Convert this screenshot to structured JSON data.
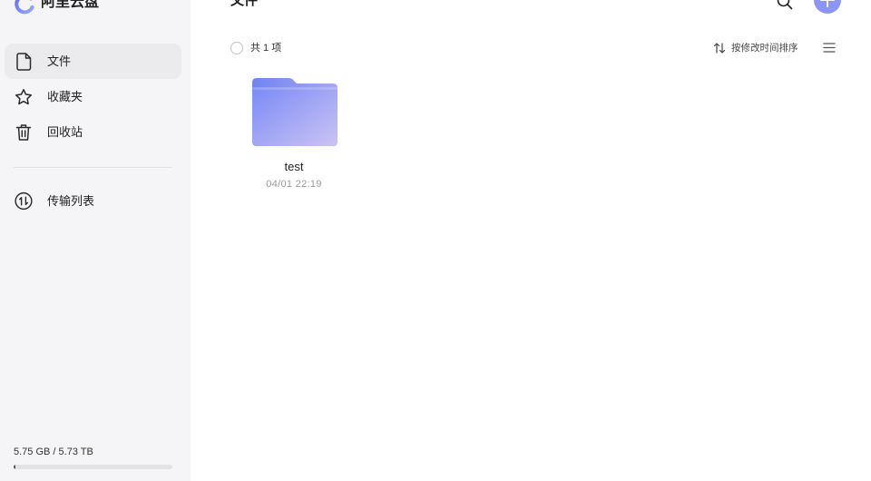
{
  "app": {
    "logo_text": "阿里云盘",
    "logo_icon": "aliyun-drive-logo"
  },
  "sidebar": {
    "nav": [
      {
        "label": "文件",
        "icon": "file-icon",
        "selected": true
      },
      {
        "label": "收藏夹",
        "icon": "star-icon",
        "selected": false
      },
      {
        "label": "回收站",
        "icon": "trash-icon",
        "selected": false
      }
    ],
    "transfer": {
      "label": "传输列表",
      "icon": "transfer-icon"
    },
    "storage": {
      "text": "5.75 GB / 5.73 TB",
      "used_fraction": 0.001
    }
  },
  "main": {
    "title": "文件",
    "search_icon": "search-icon",
    "add_icon": "plus-icon",
    "summary": "共 1 项",
    "sort_icon": "sort-icon",
    "sort_label": "按修改时间排序",
    "view_icon": "list-view-icon",
    "files": [
      {
        "name": "test",
        "modified": "04/01 22:19",
        "icon": "folder-icon"
      }
    ]
  },
  "colors": {
    "accent": "#8c95f8",
    "sidebar_bg": "#f5f5f7",
    "selected_bg": "#ebebee",
    "folder_start": "#7a8af6",
    "folder_end": "#cbc3f3"
  }
}
